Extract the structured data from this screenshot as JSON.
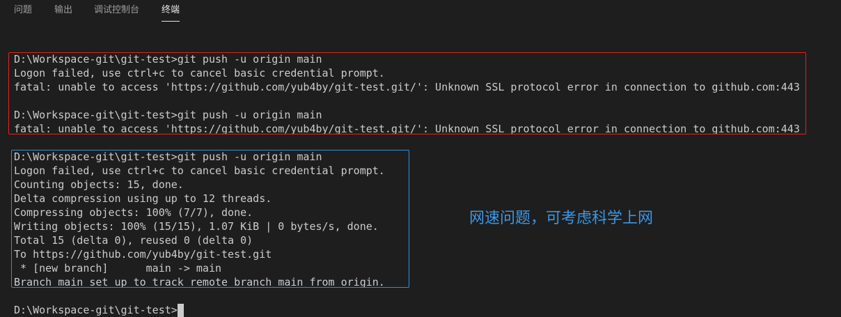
{
  "tabs": [
    {
      "label": "问题"
    },
    {
      "label": "输出"
    },
    {
      "label": "调试控制台"
    },
    {
      "label": "终端",
      "active": true
    }
  ],
  "terminal": {
    "lines": [
      "D:\\Workspace-git\\git-test>git push -u origin main",
      "Logon failed, use ctrl+c to cancel basic credential prompt.",
      "fatal: unable to access 'https://github.com/yub4by/git-test.git/': Unknown SSL protocol error in connection to github.com:443",
      "",
      "D:\\Workspace-git\\git-test>git push -u origin main",
      "fatal: unable to access 'https://github.com/yub4by/git-test.git/': Unknown SSL protocol error in connection to github.com:443",
      "",
      "D:\\Workspace-git\\git-test>git push -u origin main",
      "Logon failed, use ctrl+c to cancel basic credential prompt.",
      "Counting objects: 15, done.",
      "Delta compression using up to 12 threads.",
      "Compressing objects: 100% (7/7), done.",
      "Writing objects: 100% (15/15), 1.07 KiB | 0 bytes/s, done.",
      "Total 15 (delta 0), reused 0 (delta 0)",
      "To https://github.com/yub4by/git-test.git",
      " * [new branch]      main -> main",
      "Branch main set up to track remote branch main from origin.",
      "",
      "D:\\Workspace-git\\git-test>"
    ]
  },
  "annotation": {
    "note": "网速问题，可考虑科学上网"
  },
  "colors": {
    "background": "#1e1e1e",
    "text": "#cccccc",
    "error_box": "#e02424",
    "success_box": "#2f8fdc",
    "note": "#3a97e6"
  }
}
